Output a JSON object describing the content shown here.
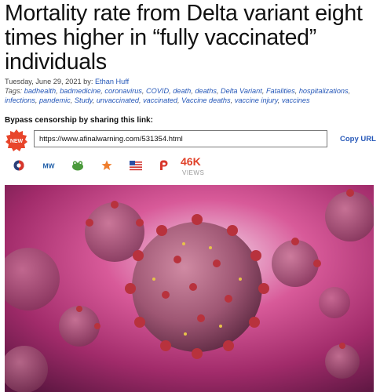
{
  "article": {
    "title": "Mortality rate from Delta variant eight times higher in “fully vaccinated” individuals",
    "date": "Tuesday, June 29, 2021",
    "by_label": "by:",
    "author": "Ethan Huff",
    "tags_label": "Tags:",
    "tags": [
      "badhealth",
      "badmedicine",
      "coronavirus",
      "COVID",
      "death",
      "deaths",
      "Delta Variant",
      "Fatalities",
      "hospitalizations",
      "infections",
      "pandemic",
      "Study",
      "unvaccinated",
      "vaccinated",
      "Vaccine deaths",
      "vaccine injury",
      "vaccines"
    ]
  },
  "share_bar": {
    "bypass_label": "Bypass censorship by sharing this link:",
    "new_badge": "NEW",
    "url": "https://www.afinalwarning.com/531354.html",
    "copy_label": "Copy URL",
    "views_count": "46K",
    "views_label": "VIEWS",
    "icons": [
      "brighteon-icon",
      "mewe-icon",
      "frog-icon",
      "star-icon",
      "gab-icon",
      "parler-icon"
    ]
  },
  "colors": {
    "link": "#2557b8",
    "accent": "#e0432b",
    "hero_bg": "#c23b78"
  }
}
